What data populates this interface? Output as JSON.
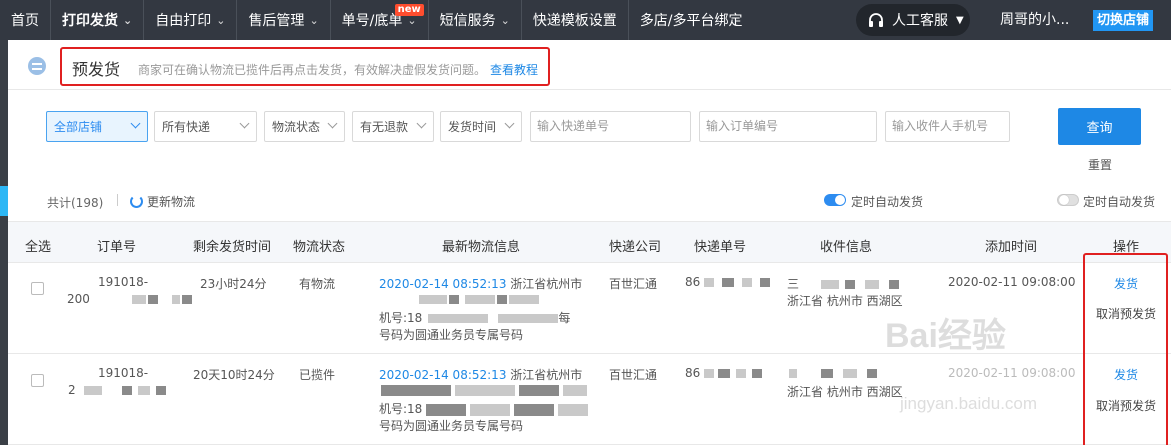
{
  "nav": {
    "items": [
      {
        "label": "首页",
        "caret": false
      },
      {
        "label": "打印发货",
        "caret": true
      },
      {
        "label": "自由打印",
        "caret": true
      },
      {
        "label": "售后管理",
        "caret": true
      },
      {
        "label": "单号/底单",
        "caret": true,
        "badge": "new"
      },
      {
        "label": "短信服务",
        "caret": true
      },
      {
        "label": "快递模板设置",
        "caret": false
      },
      {
        "label": "多店/多平台绑定",
        "caret": false
      }
    ],
    "customer_service": "人工客服",
    "user_name": "周哥的小...",
    "switch_store": "切换店铺"
  },
  "page": {
    "title": "预发货",
    "description": "商家可在确认物流已揽件后再点击发货，有效解决虚假发货问题。",
    "tutorial_link": "查看教程"
  },
  "filters": {
    "store": "全部店铺",
    "express": "所有快递",
    "logistics_status": "物流状态",
    "refund": "有无退款",
    "ship_time": "发货时间",
    "tracking_placeholder": "输入快递单号",
    "order_placeholder": "输入订单编号",
    "phone_placeholder": "输入收件人手机号",
    "query_button": "查询",
    "reset_button": "重置"
  },
  "summary": {
    "count": "共计(198)",
    "refresh": "更新物流",
    "auto_ship_on": "定时自动发货",
    "auto_ship_off": "定时自动发货"
  },
  "table": {
    "headers": {
      "select_all": "全选",
      "order_no": "订单号",
      "remaining": "剩余发货时间",
      "status": "物流状态",
      "latest_info": "最新物流信息",
      "carrier": "快递公司",
      "tracking_no": "快递单号",
      "receiver": "收件信息",
      "added": "添加时间",
      "action": "操作"
    },
    "rows": [
      {
        "order_line1": "191018-",
        "order_line2": "200",
        "remaining": "23小时24分",
        "status": "有物流",
        "info_time": "2020-02-14 08:52:13",
        "info_line1": "浙江省杭州市",
        "info_line2": "机号:18",
        "info_line2_suffix": "每",
        "info_line3": "号码为圆通业务员专属号码",
        "carrier": "百世汇通",
        "tracking": "86",
        "receiver_line1": "三",
        "receiver_line2": "浙江省 杭州市 西湖区",
        "added": "2020-02-11 09:08:00",
        "action_send": "发货",
        "action_cancel": "取消预发货"
      },
      {
        "order_line1": "191018-",
        "order_line2": "2",
        "remaining": "20天10时24分",
        "status": "已揽件",
        "info_time": "2020-02-14 08:52:13",
        "info_line1": "浙江省杭州市",
        "info_line2": "机号:18",
        "info_line2_suffix": "",
        "info_line3": "号码为圆通业务员专属号码",
        "carrier": "百世汇通",
        "tracking": "86",
        "receiver_line1": "",
        "receiver_line2": "浙江省 杭州市 西湖区",
        "added": "2020-02-11 09:08:00",
        "action_send": "发货",
        "action_cancel": "取消预发货"
      }
    ]
  },
  "watermark": {
    "logo": "Bai经验",
    "url": "jingyan.baidu.com"
  },
  "colors": {
    "nav_bg": "#333841",
    "accent": "#1e88e5",
    "highlight_border": "#e02020"
  }
}
